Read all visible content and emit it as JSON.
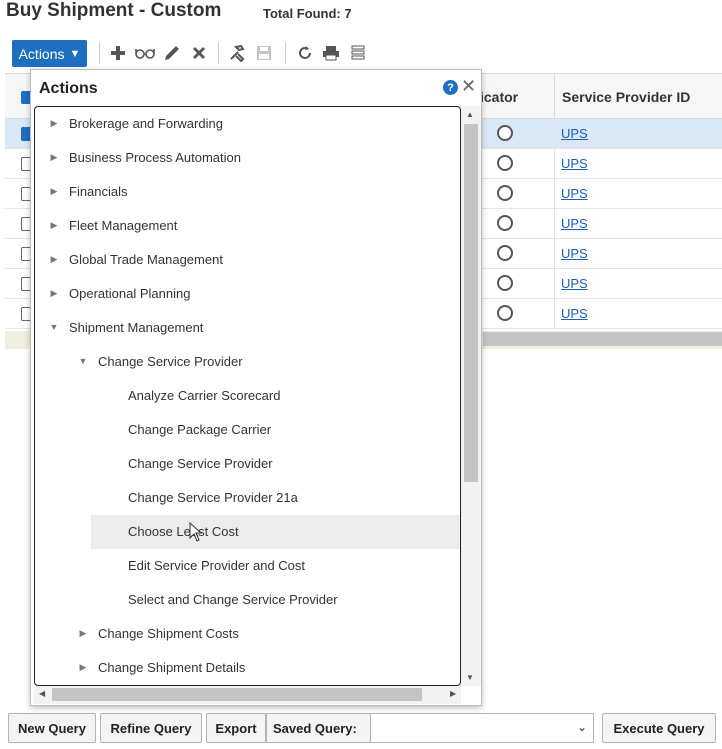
{
  "header": {
    "title": "Buy Shipment - Custom",
    "total_found": "Total Found: 7"
  },
  "toolbar": {
    "actions_label": "Actions",
    "icons": [
      "plus-icon",
      "glasses-icon",
      "pencil-icon",
      "delete-icon",
      "tools-icon",
      "save-icon",
      "refresh-icon",
      "print-icon",
      "columns-icon"
    ]
  },
  "table": {
    "columns": [
      "icator",
      "Service Provider ID"
    ],
    "rows": [
      {
        "selected": true,
        "service_provider": "UPS"
      },
      {
        "selected": false,
        "service_provider": "UPS"
      },
      {
        "selected": false,
        "service_provider": "UPS"
      },
      {
        "selected": false,
        "service_provider": "UPS"
      },
      {
        "selected": false,
        "service_provider": "UPS"
      },
      {
        "selected": false,
        "service_provider": "UPS"
      },
      {
        "selected": false,
        "service_provider": "UPS"
      }
    ]
  },
  "popup": {
    "title": "Actions",
    "help": "?",
    "close": "✕",
    "items": [
      {
        "label": "Brokerage and Forwarding",
        "level": 0,
        "state": "collapsed"
      },
      {
        "label": "Business Process Automation",
        "level": 0,
        "state": "collapsed"
      },
      {
        "label": "Financials",
        "level": 0,
        "state": "collapsed"
      },
      {
        "label": "Fleet Management",
        "level": 0,
        "state": "collapsed"
      },
      {
        "label": "Global Trade Management",
        "level": 0,
        "state": "collapsed"
      },
      {
        "label": "Operational Planning",
        "level": 0,
        "state": "collapsed"
      },
      {
        "label": "Shipment Management",
        "level": 0,
        "state": "expanded"
      },
      {
        "label": "Change Service Provider",
        "level": 1,
        "state": "expanded"
      },
      {
        "label": "Analyze Carrier Scorecard",
        "level": 2,
        "state": "leaf"
      },
      {
        "label": "Change Package Carrier",
        "level": 2,
        "state": "leaf"
      },
      {
        "label": "Change Service Provider",
        "level": 2,
        "state": "leaf"
      },
      {
        "label": "Change Service Provider 21a",
        "level": 2,
        "state": "leaf"
      },
      {
        "label": "Choose Least Cost",
        "level": 2,
        "state": "leaf",
        "hover": true
      },
      {
        "label": "Edit Service Provider and Cost",
        "level": 2,
        "state": "leaf"
      },
      {
        "label": "Select and Change Service Provider",
        "level": 2,
        "state": "leaf"
      },
      {
        "label": "Change Shipment Costs",
        "level": 1,
        "state": "collapsed"
      },
      {
        "label": "Change Shipment Details",
        "level": 1,
        "state": "collapsed"
      }
    ]
  },
  "bottom": {
    "new_query": "New Query",
    "refine_query": "Refine Query",
    "export": "Export",
    "saved_query_label": "Saved Query:",
    "saved_query_value": "",
    "execute_query": "Execute Query"
  },
  "colors": {
    "accent": "#1f6fc1",
    "selected_row": "#d9e8f7",
    "hover_row": "#ececec",
    "link": "#1a5fb4"
  }
}
